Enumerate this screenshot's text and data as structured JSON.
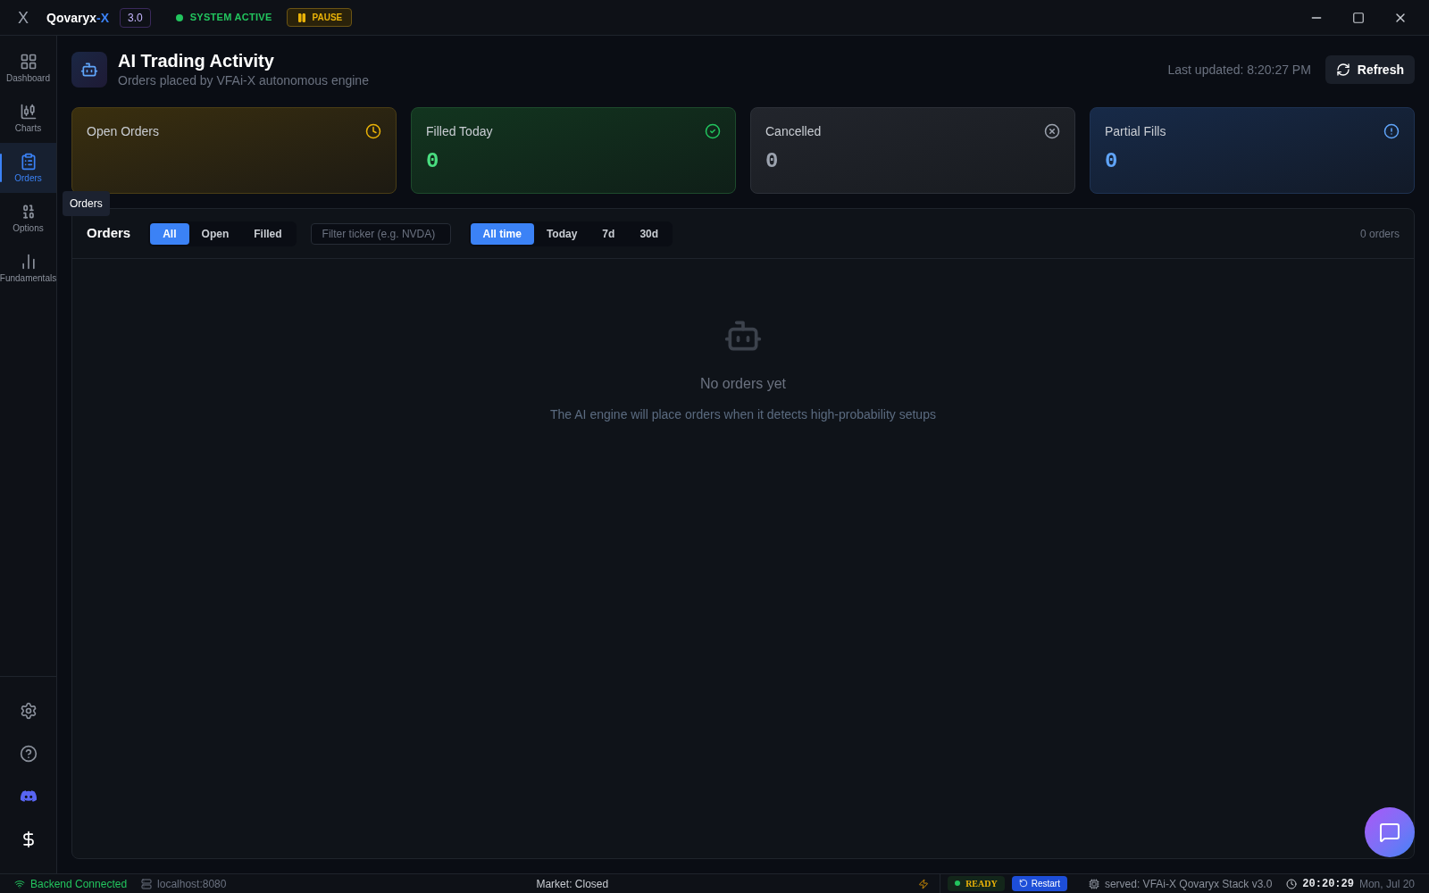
{
  "titlebar": {
    "logo": "X",
    "brand": {
      "name": "Qovaryx",
      "suffix": "-X"
    },
    "version": "3.0",
    "status": {
      "label": "SYSTEM ACTIVE",
      "active": true
    },
    "pause_button": "PAUSE"
  },
  "sidebar": {
    "items": [
      {
        "label": "Dashboard",
        "kind": "dashboard",
        "selected": false
      },
      {
        "label": "Charts",
        "kind": "charts",
        "selected": false
      },
      {
        "label": "Orders",
        "kind": "orders",
        "selected": true
      },
      {
        "label": "Options",
        "kind": "options",
        "selected": false
      },
      {
        "label": "Fundamentals",
        "kind": "fundamentals",
        "selected": false
      }
    ],
    "tooltip": "Orders",
    "bottom": [
      {
        "kind": "settings"
      },
      {
        "kind": "help"
      },
      {
        "kind": "chat"
      },
      {
        "kind": "dollar"
      }
    ]
  },
  "header": {
    "title": "AI Trading Activity",
    "subtitle": "Orders placed by VFAi-X autonomous engine",
    "last_updated": "Last updated: 8:20:27 PM",
    "refresh_button": "Refresh"
  },
  "stats": [
    {
      "label": "Open Orders",
      "kind": "open"
    },
    {
      "label": "Filled Today",
      "value": "0",
      "kind": "filled"
    },
    {
      "label": "Cancelled",
      "value": "0",
      "kind": "cancelled"
    },
    {
      "label": "Partial Fills",
      "value": "0",
      "kind": "partial"
    }
  ],
  "orders": {
    "title": "Orders",
    "status_tabs": [
      {
        "label": "All",
        "selected": true
      },
      {
        "label": "Open",
        "selected": false
      },
      {
        "label": "Filled",
        "selected": false
      }
    ],
    "filter": {
      "placeholder": "Filter ticker (e.g. NVDA)"
    },
    "range_tabs": [
      {
        "label": "All time",
        "selected": true
      },
      {
        "label": "Today",
        "selected": false
      },
      {
        "label": "7d",
        "selected": false
      },
      {
        "label": "30d",
        "selected": false
      }
    ],
    "count": "0 orders",
    "empty": {
      "title": "No orders yet",
      "message": "The AI engine will place orders when it detects high-probability setups"
    }
  },
  "status_bar": {
    "connection": "Backend Connected",
    "host": "localhost:8080",
    "market": "Market: Closed",
    "ready": "READY",
    "restart_button": "Restart",
    "served": "served: VFAi-X Qovaryx Stack v3.0",
    "time": "20:20:29",
    "date": "Mon, Jul 20"
  }
}
